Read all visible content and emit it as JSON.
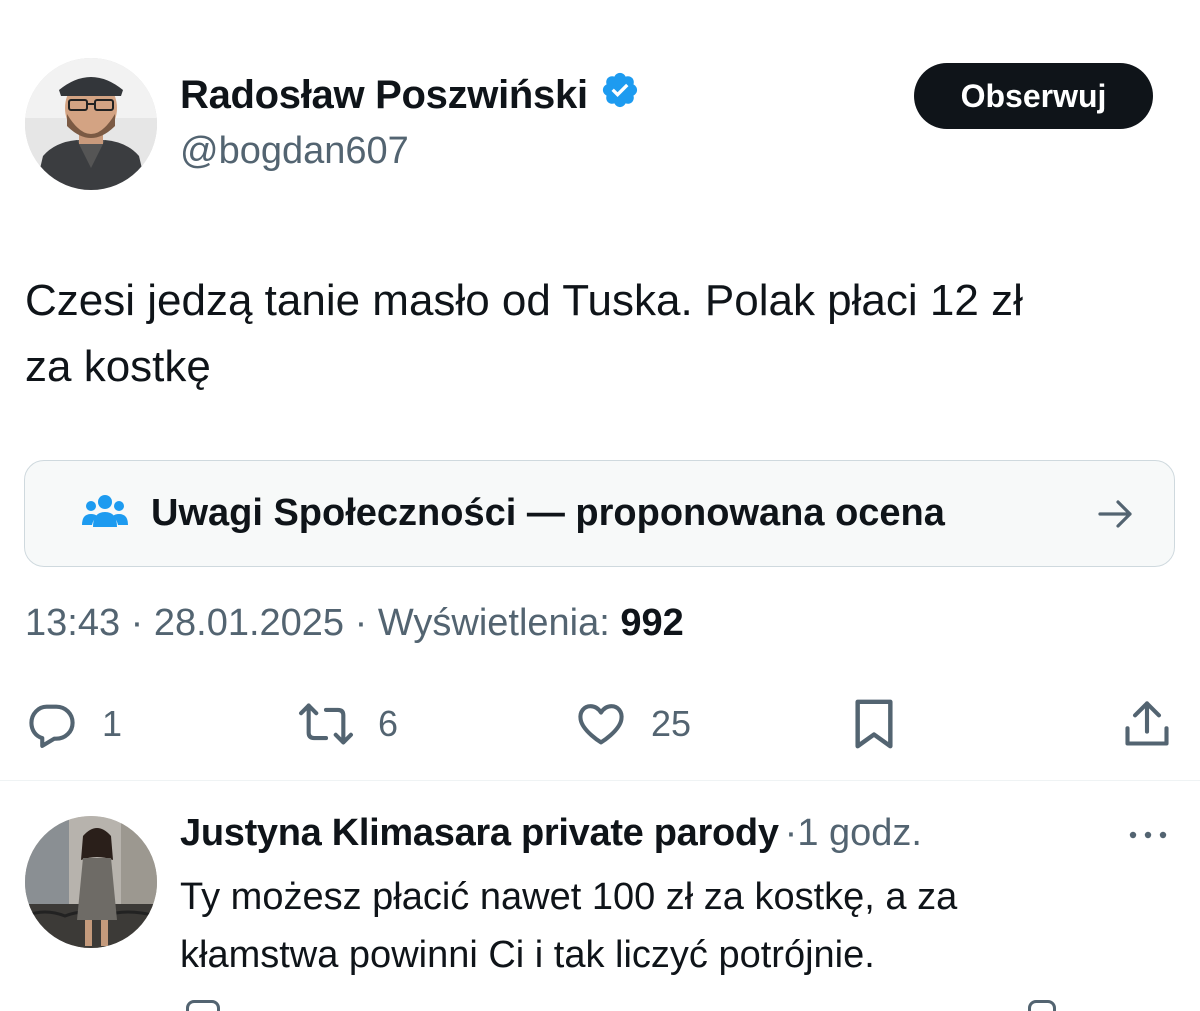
{
  "tweet": {
    "author": {
      "name": "Radosław Poszwiński",
      "handle": "@bogdan607",
      "verified": true
    },
    "follow_label": "Obserwuj",
    "text_line1": "Czesi jedzą tanie masło od Tuska. Polak płaci 12 zł",
    "text_line2": "za kostkę",
    "community_notes": {
      "label": "Uwagi Społeczności — proponowana ocena",
      "icon": "community-people-icon"
    },
    "meta": {
      "time": "13:43",
      "sep1": " · ",
      "date": "28.01.2025",
      "sep2": " · ",
      "views_label": "Wyświetlenia: ",
      "views_count": "992"
    },
    "actions": {
      "replies": "1",
      "retweets": "6",
      "likes": "25"
    }
  },
  "reply": {
    "author": "Justyna Klimasara private parody",
    "separator": "·",
    "time": "1 godz.",
    "text_line1": "Ty możesz płacić nawet 100 zł za kostkę, a za",
    "text_line2": "kłamstwa powinni Ci i tak liczyć potrójnie."
  },
  "colors": {
    "text": "#0f1419",
    "secondary": "#536471",
    "verified": "#1d9bf0",
    "notes_icon": "#1d9bf0",
    "border": "#cfd9de",
    "notes_bg": "#f7f9f9",
    "button_bg": "#0f1419"
  }
}
